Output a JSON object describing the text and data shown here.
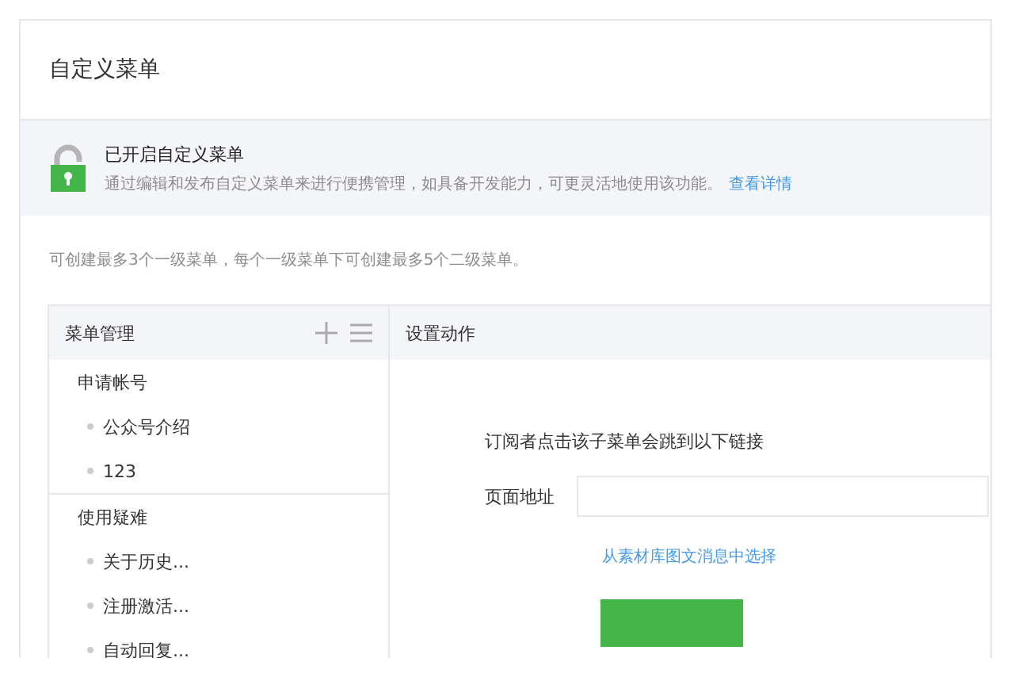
{
  "page": {
    "title": "自定义菜单"
  },
  "notice": {
    "title": "已开启自定义菜单",
    "text": "通过编辑和发布自定义菜单来进行便携管理，如具备开发能力，可更灵活地使用该功能。",
    "link": "查看详情"
  },
  "tip": "可创建最多3个一级菜单，每个一级菜单下可创建最多5个二级菜单。",
  "menu_panel": {
    "title": "菜单管理",
    "groups": [
      {
        "label": "申请帐号",
        "children": [
          {
            "label": "公众号介绍"
          },
          {
            "label": "123"
          }
        ]
      },
      {
        "label": "使用疑难",
        "children": [
          {
            "label": "关于历史..."
          },
          {
            "label": "注册激活..."
          },
          {
            "label": "自动回复..."
          }
        ]
      }
    ]
  },
  "action_panel": {
    "title": "设置动作",
    "description": "订阅者点击该子菜单会跳到以下链接",
    "url_field": {
      "label": "页面地址"
    },
    "link": "从素材库图文消息中选择"
  }
}
